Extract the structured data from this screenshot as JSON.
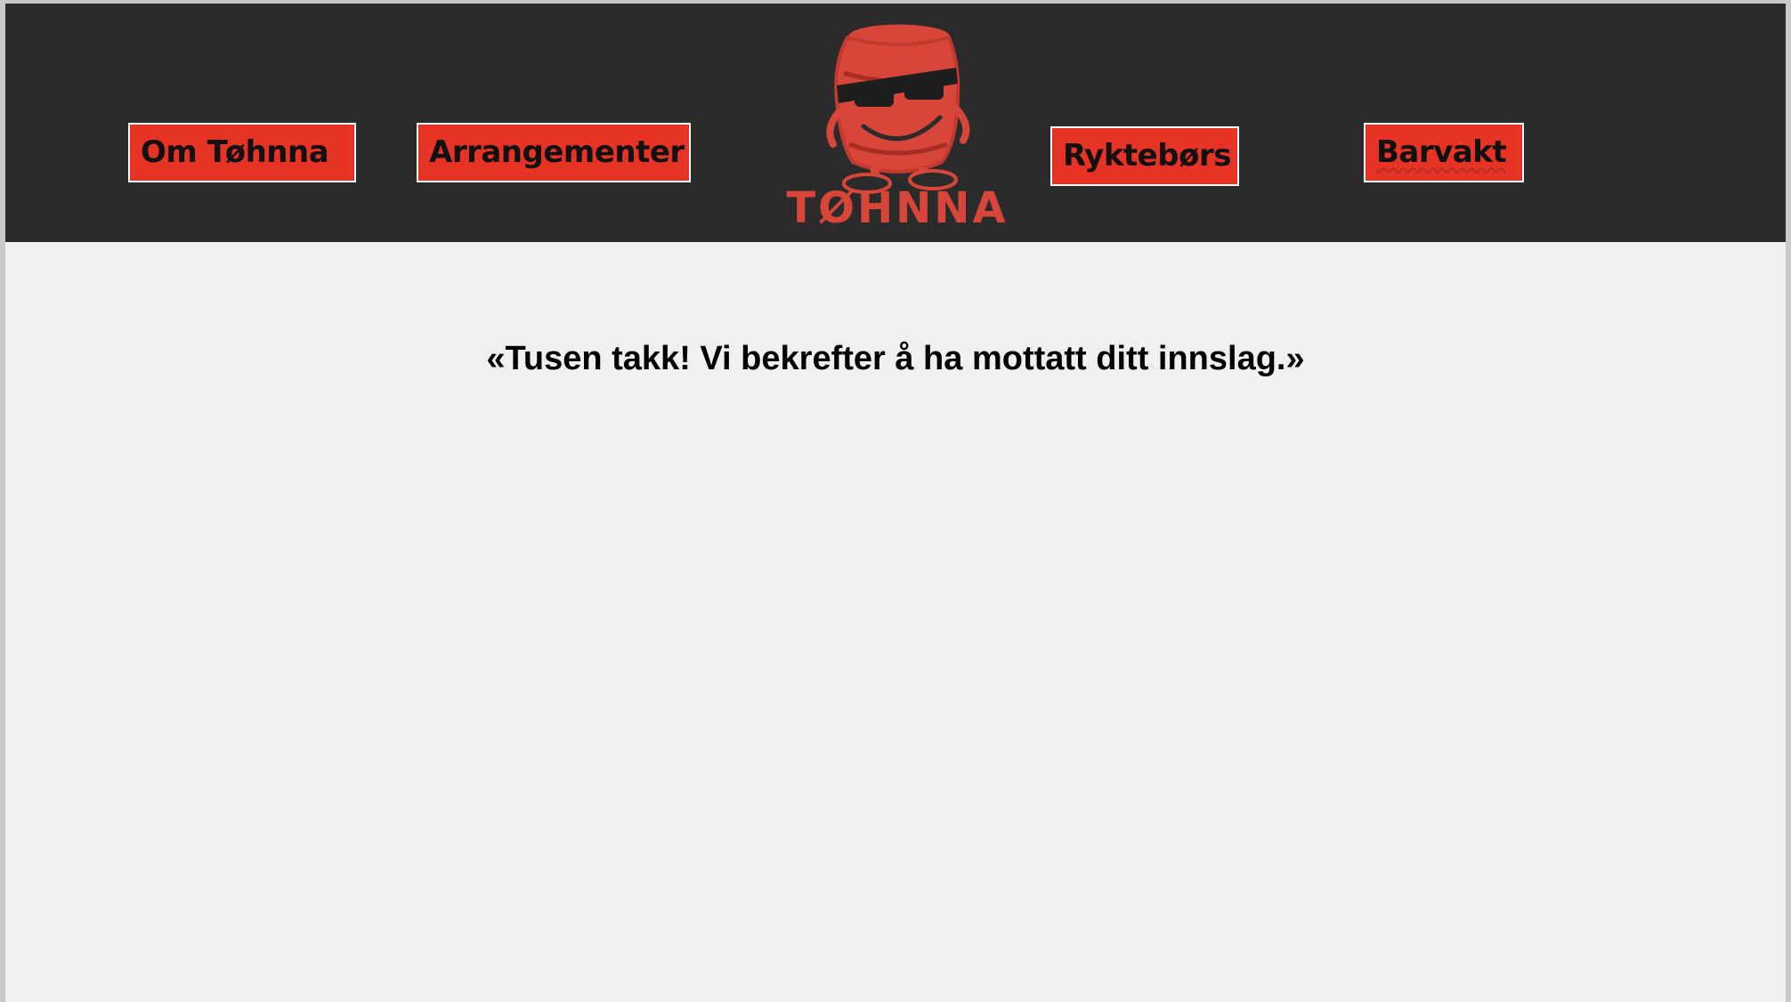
{
  "colors": {
    "header_bg": "#2b2b2b",
    "accent_red": "#e63325",
    "page_bg": "#f0f0f0",
    "text": "#000000"
  },
  "nav": {
    "items": [
      {
        "label": "Om Tøhnna"
      },
      {
        "label": "Arrangementer"
      },
      {
        "label": "Ryktebørs"
      },
      {
        "label": "Barvakt"
      }
    ]
  },
  "logo": {
    "icon": "keg-mascot-with-sunglasses",
    "wordmark": "TØHNNA"
  },
  "main": {
    "confirmation": "«Tusen takk! Vi bekrefter å ha mottatt ditt innslag.»"
  }
}
